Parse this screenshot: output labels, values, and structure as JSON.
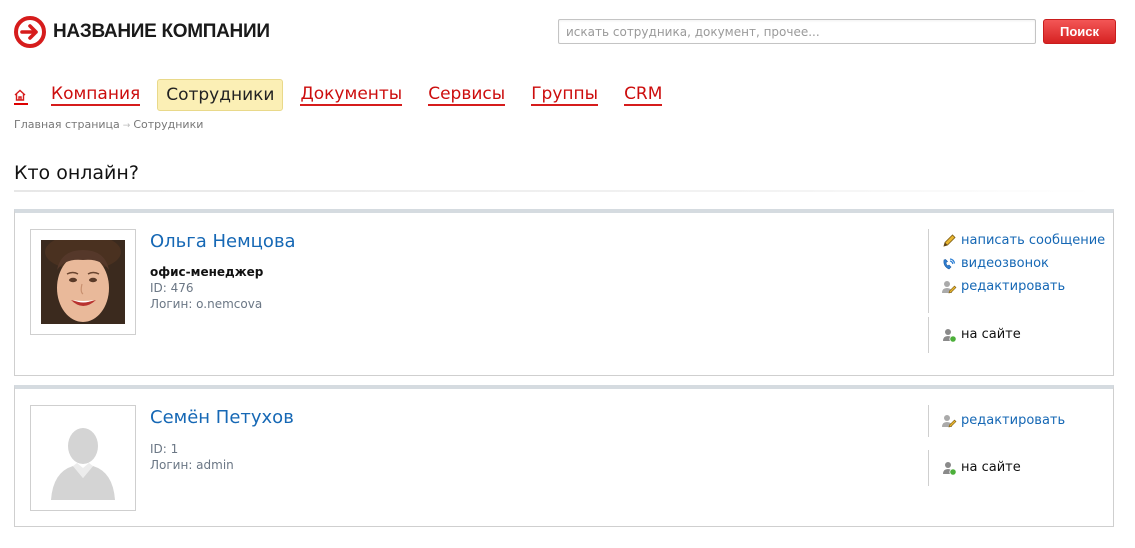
{
  "header": {
    "company_name": "НАЗВАНИЕ КОМПАНИИ",
    "search_placeholder": "искать сотрудника, документ, прочее...",
    "search_button": "Поиск",
    "accent_color": "#d61c1c"
  },
  "nav": {
    "home_icon": "home-icon",
    "items": [
      {
        "label": "Компания",
        "active": false
      },
      {
        "label": "Сотрудники",
        "active": true
      },
      {
        "label": "Документы",
        "active": false
      },
      {
        "label": "Сервисы",
        "active": false
      },
      {
        "label": "Группы",
        "active": false
      },
      {
        "label": "CRM",
        "active": false
      }
    ]
  },
  "breadcrumb": {
    "items": [
      "Главная страница",
      "Сотрудники"
    ],
    "separator": "→"
  },
  "page": {
    "title": "Кто онлайн?"
  },
  "employees": [
    {
      "name": "Ольга Немцова",
      "position": "офис-менеджер",
      "id_line": "ID: 476",
      "login_line": "Логин: o.nemcova",
      "avatar": "photo",
      "actions": [
        {
          "label": "написать сообщение",
          "icon": "pencil-icon"
        },
        {
          "label": "видеозвонок",
          "icon": "phone-icon"
        },
        {
          "label": "редактировать",
          "icon": "edit-user-icon"
        }
      ],
      "status": "на сайте",
      "status_icon": "user-online-icon"
    },
    {
      "name": "Семён Петухов",
      "position": "",
      "id_line": "ID: 1",
      "login_line": "Логин: admin",
      "avatar": "placeholder",
      "actions": [
        {
          "label": "редактировать",
          "icon": "edit-user-icon"
        }
      ],
      "status": "на сайте",
      "status_icon": "user-online-icon"
    }
  ]
}
